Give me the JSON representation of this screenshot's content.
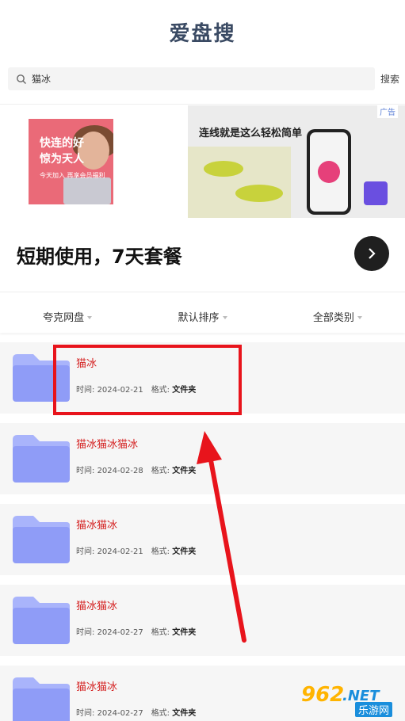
{
  "app": {
    "title": "爱盘搜"
  },
  "search": {
    "value": "猫冰",
    "button_label": "搜索"
  },
  "ad": {
    "tag": "广告",
    "left_line1": "快连的好",
    "left_line2": "惊为天人",
    "left_line3": "今天加入 再享会员福利",
    "right_headline": "连线就是这么轻松简单",
    "caption": "短期使用，7天套餐"
  },
  "filters": [
    {
      "label": "夸克网盘"
    },
    {
      "label": "默认排序"
    },
    {
      "label": "全部类别"
    }
  ],
  "results": [
    {
      "title": "猫冰",
      "time_label": "时间:",
      "date": "2024-02-21",
      "format_label": "格式:",
      "format": "文件夹"
    },
    {
      "title": "猫冰猫冰猫冰",
      "time_label": "时间:",
      "date": "2024-02-28",
      "format_label": "格式:",
      "format": "文件夹"
    },
    {
      "title": "猫冰猫冰",
      "time_label": "时间:",
      "date": "2024-02-21",
      "format_label": "格式:",
      "format": "文件夹"
    },
    {
      "title": "猫冰猫冰",
      "time_label": "时间:",
      "date": "2024-02-27",
      "format_label": "格式:",
      "format": "文件夹"
    },
    {
      "title": "猫冰猫冰",
      "time_label": "时间:",
      "date": "2024-02-27",
      "format_label": "格式:",
      "format": "文件夹"
    }
  ],
  "watermark": {
    "number": "962",
    "suffix": ".NET",
    "site": "乐游网"
  },
  "colors": {
    "title": "#3a4a63",
    "result_title": "#d42020",
    "highlight": "#e8141c",
    "folder": "#8f9cf7"
  },
  "icons": {
    "search": "search-icon",
    "folder": "folder-icon",
    "arrow": "arrow-right-icon"
  }
}
